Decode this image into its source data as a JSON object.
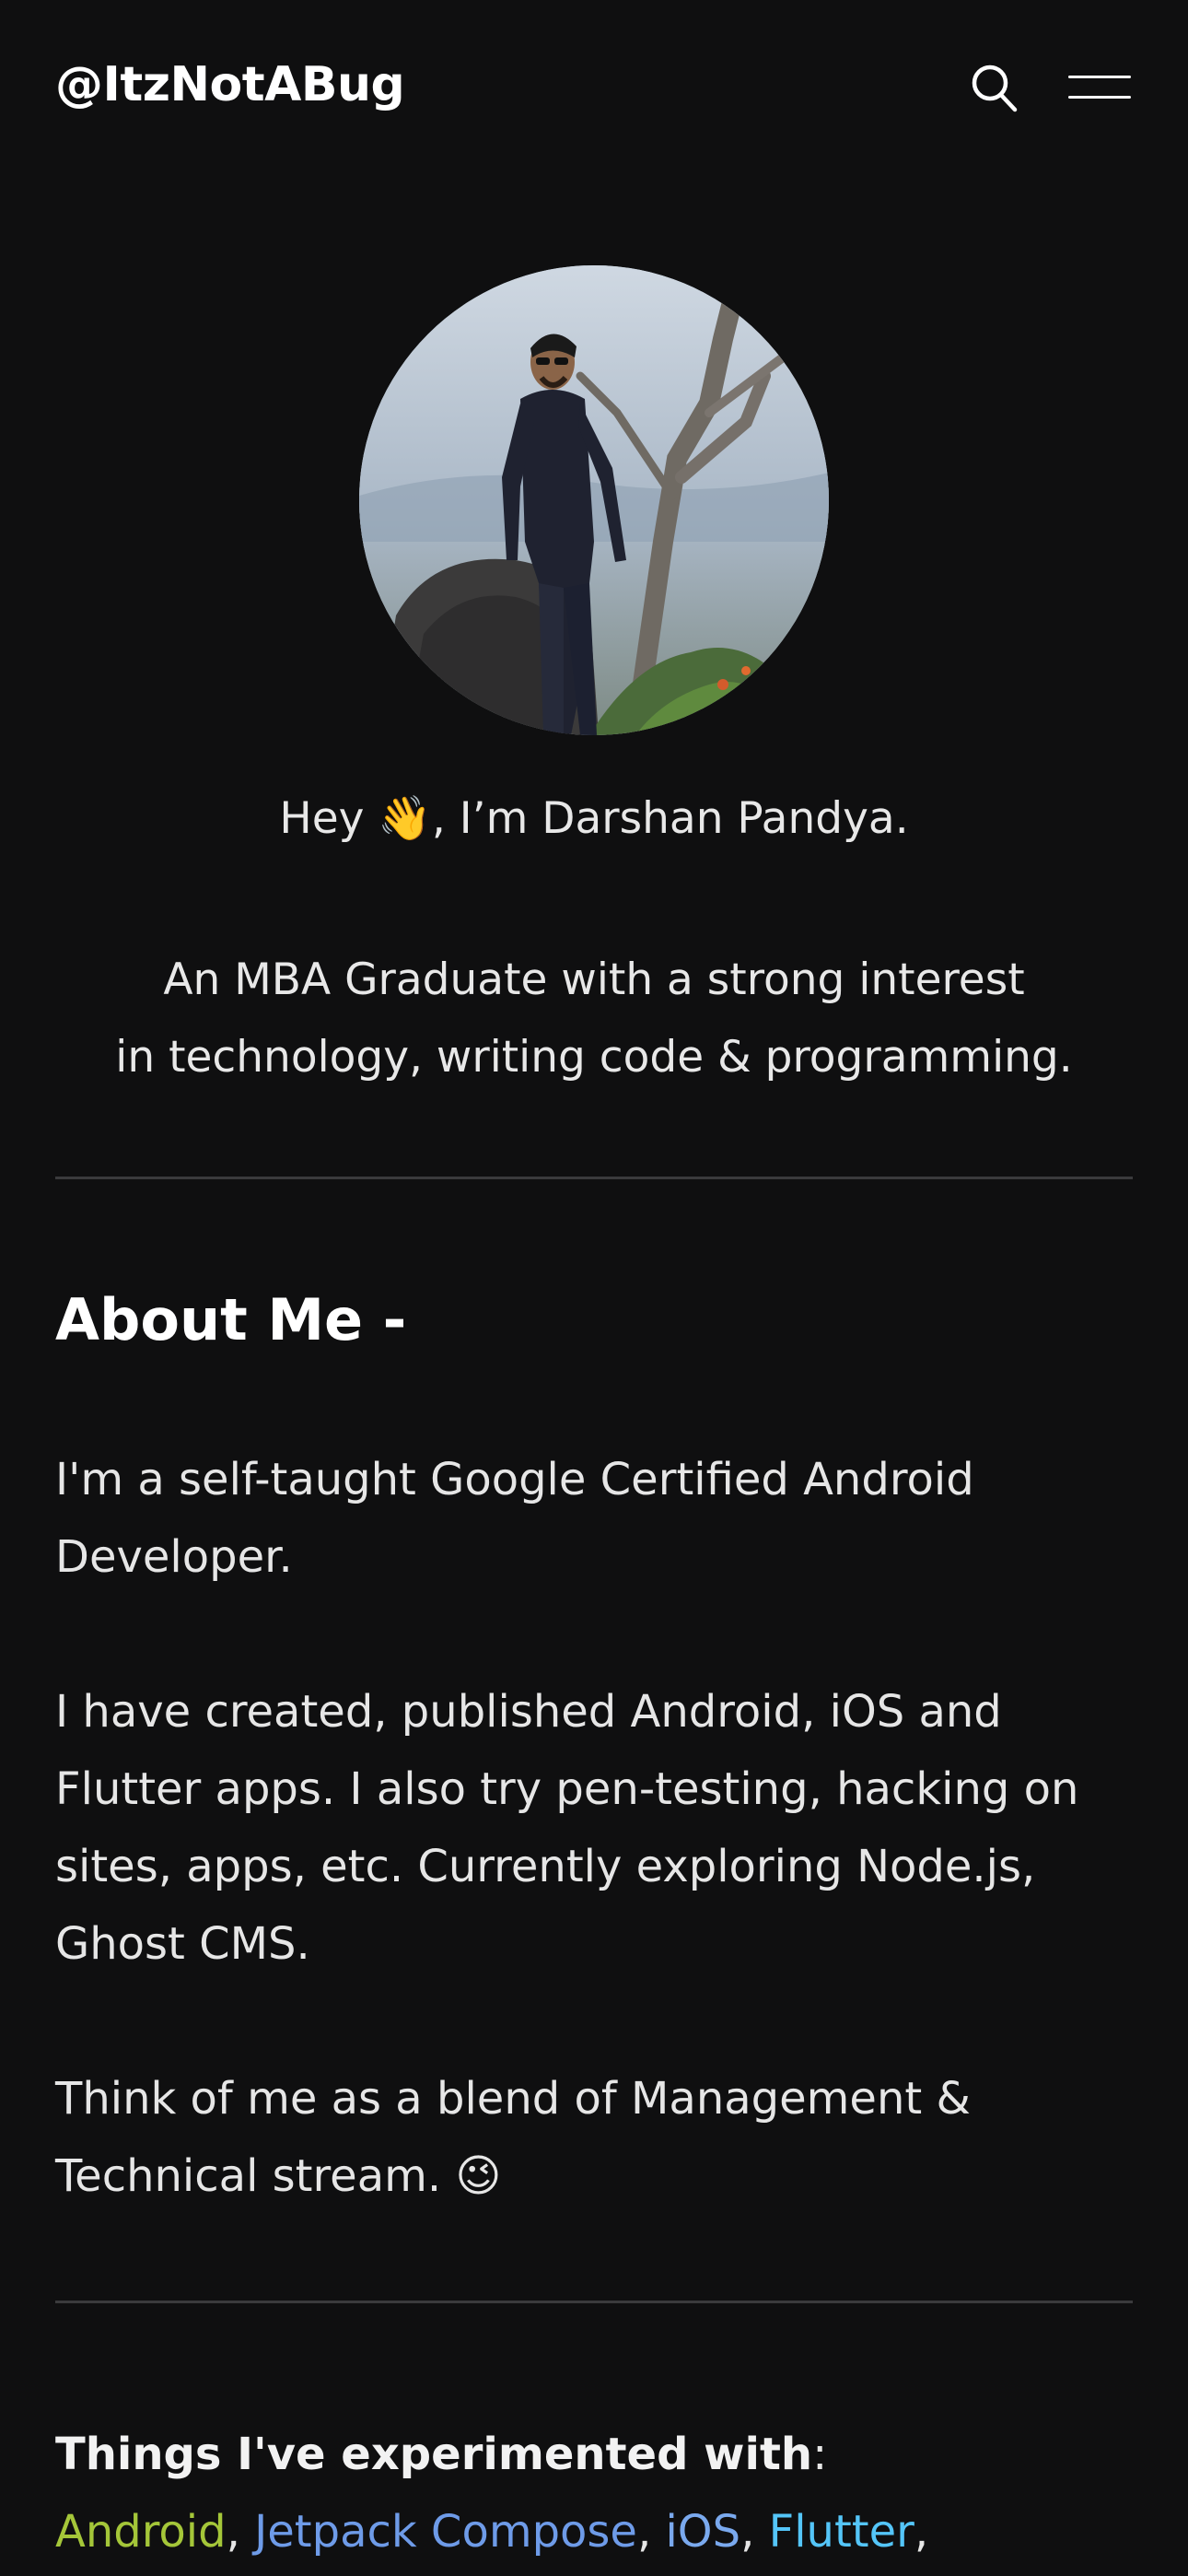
{
  "header": {
    "site_title": "@ItzNotABug"
  },
  "intro": {
    "greeting_prefix": "Hey ",
    "greeting_emoji": "👋",
    "greeting_suffix": ", I’m Darshan Pandya.",
    "tagline_line1": "An MBA Graduate with a strong interest",
    "tagline_line2": "in technology, writing code & programming."
  },
  "about": {
    "heading": "About Me -",
    "p1": "I'm a self-taught Google Certified Android Developer.",
    "p2": "I have created, published Android, iOS and Flutter apps. I also try pen-testing, hacking on sites, apps, etc. Currently exploring Node.js, Ghost CMS.",
    "p3_text": "Think of me as a blend of Management & Technical stream. ",
    "p3_emoji": "😉"
  },
  "things": {
    "label": "Things I've experimented with",
    "colon": ":",
    "items": [
      {
        "label": "Android",
        "color": "#a4c639"
      },
      {
        "label": "Jetpack Compose",
        "color": "#6e9be8"
      },
      {
        "label": "iOS",
        "color": "#7aa9ee"
      },
      {
        "label": "Flutter",
        "color": "#54c5f8"
      }
    ]
  },
  "colors": {
    "background": "#0f0f10",
    "text": "#e6e6e6",
    "divider": "#3a3a3c"
  }
}
